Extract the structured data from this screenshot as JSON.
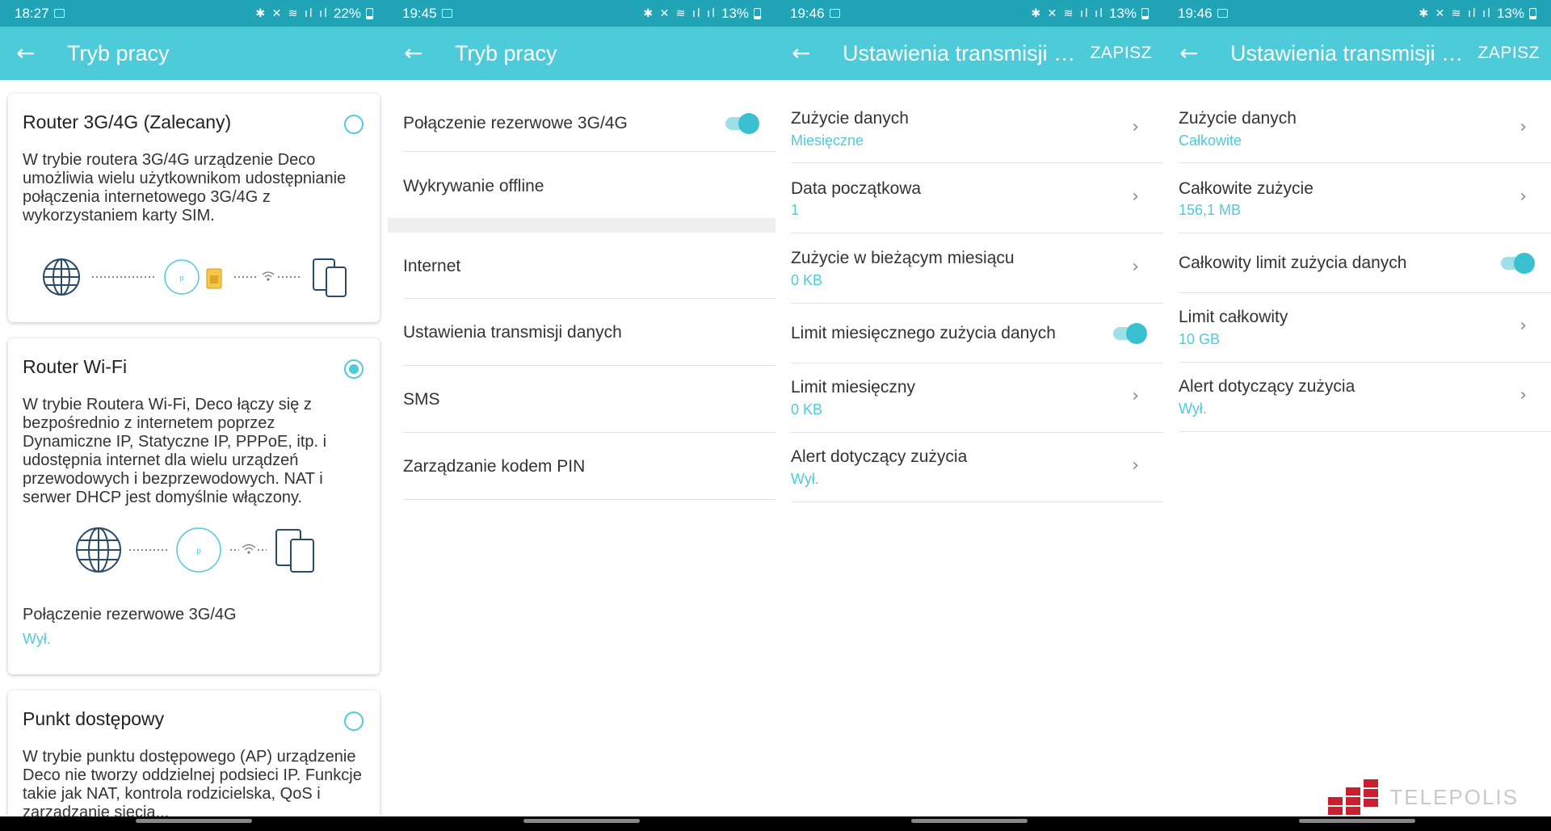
{
  "colors": {
    "accent": "#4ecbd9",
    "status_bar": "#21a4b5",
    "watermark_red": "#c7202f"
  },
  "panel1": {
    "status": {
      "time": "18:27",
      "battery": "22%"
    },
    "title": "Tryb pracy",
    "back_icon": "arrow-left-icon",
    "cards": [
      {
        "title": "Router 3G/4G (Zalecany)",
        "selected": false,
        "description": "W trybie routera 3G/4G urządzenie Deco umożliwia wielu użytkownikom udostępnianie połączenia internetowego 3G/4G z wykorzystaniem karty SIM."
      },
      {
        "title": "Router Wi-Fi",
        "selected": true,
        "description": "W trybie Routera Wi-Fi, Deco łączy się z bezpośrednio z internetem poprzez Dynamiczne IP, Statyczne IP, PPPoE, itp. i udostępnia internet dla wielu urządzeń przewodowych i bezprzewodowych. NAT i serwer DHCP jest domyślnie włączony.",
        "sub_label": "Połączenie rezerwowe 3G/4G",
        "sub_value": "Wył."
      },
      {
        "title": "Punkt dostępowy",
        "selected": false,
        "description": "W trybie punktu dostępowego (AP) urządzenie Deco nie tworzy oddzielnej podsieci IP. Funkcje takie jak NAT, kontrola rodzicielska, QoS i zarządzanie siecią..."
      }
    ]
  },
  "panel2": {
    "status": {
      "time": "19:45",
      "battery": "13%"
    },
    "title": "Tryb pracy",
    "rows_top": [
      {
        "label": "Połączenie rezerwowe 3G/4G",
        "toggle": true
      },
      {
        "label": "Wykrywanie offline"
      }
    ],
    "rows_bottom": [
      {
        "label": "Internet"
      },
      {
        "label": "Ustawienia transmisji danych"
      },
      {
        "label": "SMS"
      },
      {
        "label": "Zarządzanie kodem PIN"
      }
    ]
  },
  "panel3": {
    "status": {
      "time": "19:46",
      "battery": "13%"
    },
    "title": "Ustawienia transmisji danych",
    "save_label": "ZAPISZ",
    "rows": [
      {
        "label": "Zużycie danych",
        "value": "Miesięczne"
      },
      {
        "label": "Data początkowa",
        "value": "1"
      },
      {
        "label": "Zużycie w bieżącym miesiącu",
        "value": "0 KB"
      },
      {
        "label": "Limit miesięcznego zużycia danych",
        "toggle": true
      },
      {
        "label": "Limit miesięczny",
        "value": "0 KB"
      },
      {
        "label": "Alert dotyczący zużycia",
        "value": "Wył."
      }
    ]
  },
  "panel4": {
    "status": {
      "time": "19:46",
      "battery": "13%"
    },
    "title": "Ustawienia transmisji danych",
    "save_label": "ZAPISZ",
    "rows": [
      {
        "label": "Zużycie danych",
        "value": "Całkowite"
      },
      {
        "label": "Całkowite zużycie",
        "value": "156,1 MB"
      },
      {
        "label": "Całkowity limit zużycia danych",
        "toggle": true
      },
      {
        "label": "Limit całkowity",
        "value": "10 GB"
      },
      {
        "label": "Alert dotyczący zużycia",
        "value": "Wył."
      }
    ]
  },
  "watermark": {
    "text": "TELEPOLIS"
  }
}
